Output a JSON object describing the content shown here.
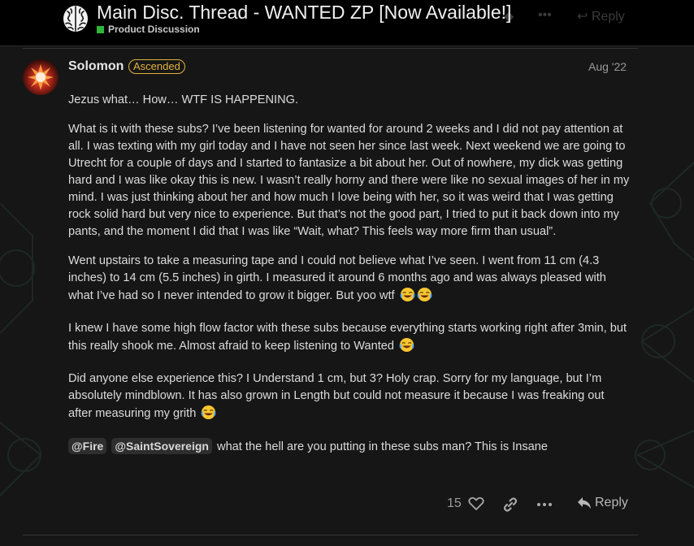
{
  "topic": {
    "title": "Main Disc. Thread - WANTED ZP [Now Available!]",
    "category": "Product Discussion",
    "category_color": "#2fb53a",
    "header_reply_label": "Reply"
  },
  "post": {
    "username": "Solomon",
    "badge": "Ascended",
    "badge_color": "#e2b33b",
    "date": "Aug '22",
    "paragraphs": [
      "Jezus what… How… WTF IS HAPPENING.",
      "What is it with these subs? I’ve been listening for wanted for around 2 weeks and I did not pay attention at all. I was texting with my girl today and I have not seen her since last week. Next weekend we are going to Utrecht for a couple of days and I started to fantasize a bit about her. Out of nowhere, my dick was getting hard and I was like okay this is new. I wasn’t really horny and there were like no sexual images of her in my mind. I was just thinking about her and how much I love being with her, so it was weird that I was getting rock solid hard but very nice to experience. But that’s not the good part, I tried to put it back down into my pants, and the moment I did that I was like “Wait, what? This feels way more firm than usual”.",
      "Went upstairs to take a measuring tape and I could not believe what I’ve seen. I went from 11 cm (4.3 inches) to 14 cm (5.5 inches) in girth. I measured it around 6 months ago and was always pleased with what I’ve had so I never intended to grow it bigger. But yoo wtf",
      "I knew I have some high flow factor with these subs because everything starts working right after 3min, but this really shook me. Almost afraid to keep listening to Wanted",
      "Did anyone else experience this? I Understand 1 cm, but 3? Holy crap. Sorry for my language, but I’m absolutely mindblown. It has also grown in Length but could not measure it because I was freaking out after measuring my grith"
    ],
    "mentions": [
      "@Fire",
      "@SaintSovereign"
    ],
    "closing_text": "what the hell are you putting in these subs man? This is Insane",
    "like_count": "15",
    "reply_label": "Reply"
  },
  "icons": {
    "logo": "brain-icon",
    "emoji": "joy-emoji-icon",
    "like": "heart-icon",
    "share": "link-icon",
    "more": "ellipsis-icon",
    "reply": "reply-arrow-icon"
  }
}
